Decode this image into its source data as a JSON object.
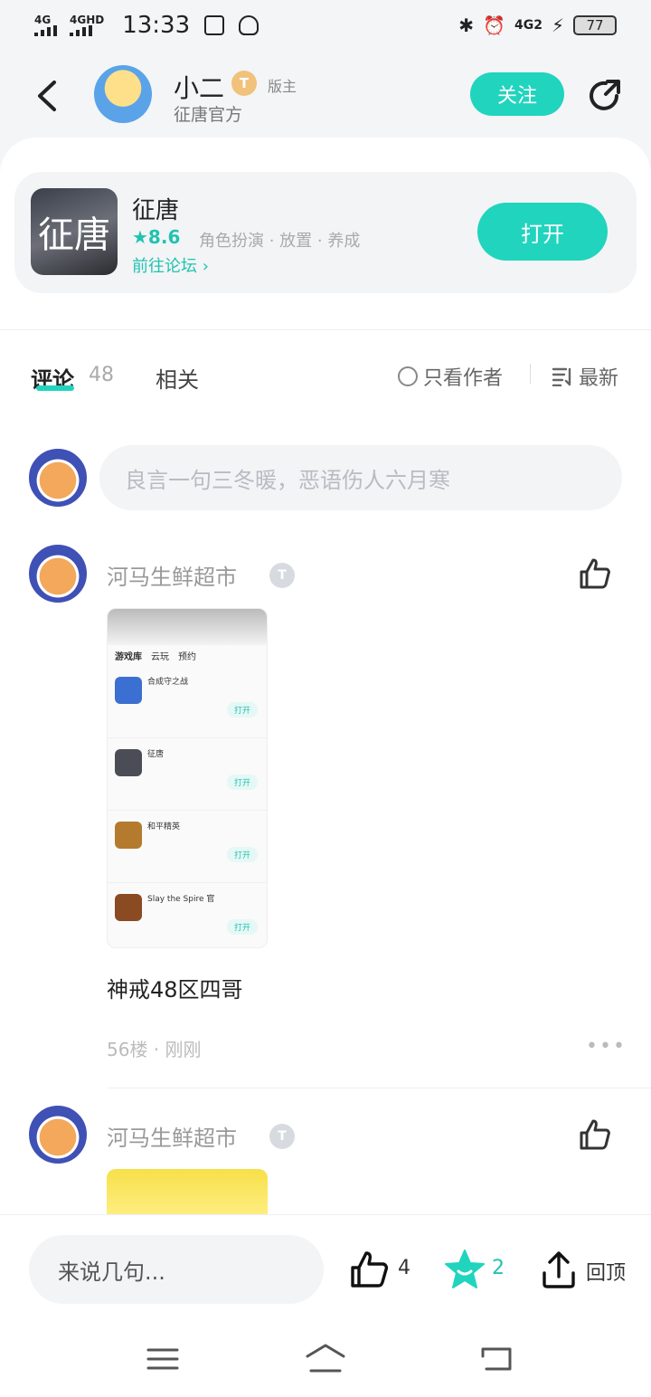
{
  "status": {
    "time": "13:33",
    "net1": "4G",
    "net2": "4GHD",
    "battery": "77",
    "net_right": "4G2"
  },
  "header": {
    "author": "小二",
    "badge": "T",
    "role": "版主",
    "subtitle": "征唐官方",
    "follow": "关注"
  },
  "game": {
    "icon_text": "征唐",
    "name": "征唐",
    "score": "★8.6",
    "tags": "角色扮演 · 放置 · 养成",
    "forum_link": "前往论坛 ›",
    "open": "打开"
  },
  "tabs": {
    "comment": "评论",
    "comment_count": "48",
    "related": "相关",
    "only_author": "只看作者",
    "sort": "最新"
  },
  "compose": {
    "placeholder": "良言一句三冬暖，恶语伤人六月寒"
  },
  "comments": [
    {
      "user": "河马生鲜超市",
      "text": "神戒48区四哥",
      "meta": "56楼 · 刚刚"
    },
    {
      "user": "河马生鲜超市"
    }
  ],
  "thumb": {
    "tabs": [
      "游戏库",
      "云玩",
      "预约"
    ],
    "rows": [
      {
        "title": "合成守之战",
        "open": "打开"
      },
      {
        "title": "征唐",
        "open": "打开"
      },
      {
        "title": "和平精英",
        "open": "打开"
      },
      {
        "title": "Slay the Spire 官",
        "open": "打开"
      }
    ]
  },
  "bottom": {
    "say": "来说几句...",
    "like_count": "4",
    "fav_count": "2",
    "top": "回顶"
  },
  "colors": {
    "accent": "#21d4be"
  }
}
